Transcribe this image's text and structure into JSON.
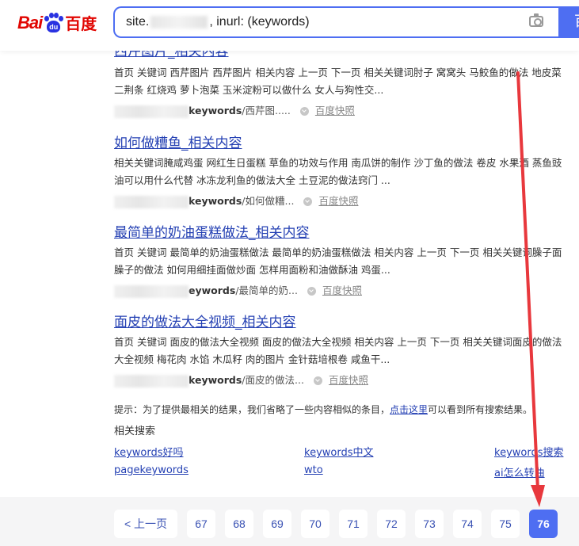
{
  "header": {
    "logo_latin": "Bai",
    "logo_paw": "du",
    "logo_cn": "百度",
    "search_prefix": "site.",
    "search_suffix": ", inurl: (keywords)",
    "search_button": "百"
  },
  "results": [
    {
      "title": "西芹图片_相关内容",
      "abstract": "首页 关键词 西芹图片 西芹图片 相关内容 上一页 下一页 相关关键词肘子 窝窝头 马鲛鱼的做法 地皮菜 二荆条 红烧鸡 萝卜泡菜 玉米淀粉可以做什么 女人与狗性交...",
      "url_bold": "keywords",
      "url_rest": "/西芹图.....",
      "snapshot": "百度快照"
    },
    {
      "title": "如何做糟鱼_相关内容",
      "abstract": "相关关键词腌咸鸡蛋 网红生日蛋糕 草鱼的功效与作用 南瓜饼的制作 沙丁鱼的做法 卷皮 水果酒 蒸鱼豉油可以用什么代替 冰冻龙利鱼的做法大全 土豆泥的做法窍门 ...",
      "url_bold": "keywords",
      "url_rest": "/如何做糟...",
      "snapshot": "百度快照"
    },
    {
      "title": "最简单的奶油蛋糕做法_相关内容",
      "abstract": "首页 关键词 最简单的奶油蛋糕做法 最简单的奶油蛋糕做法 相关内容 上一页 下一页 相关关键词臊子面臊子的做法 如何用细挂面做炒面 怎样用面粉和油做酥油 鸡蛋...",
      "url_bold": "eywords",
      "url_rest": "/最简单的奶...",
      "snapshot": "百度快照"
    },
    {
      "title": "面皮的做法大全视频_相关内容",
      "abstract": "首页 关键词 面皮的做法大全视频 面皮的做法大全视频 相关内容 上一页 下一页 相关关键词面皮的做法大全视频 梅花肉 水馅 木瓜籽 肉的图片 金针菇培根卷 咸鱼干...",
      "url_bold": "keywords",
      "url_rest": "/面皮的做法...",
      "snapshot": "百度快照"
    }
  ],
  "tip": {
    "prefix": "提示：为了提供最相关的结果，我们省略了一些内容相似的条目，",
    "link": "点击这里",
    "suffix": "可以看到所有搜索结果。"
  },
  "related": {
    "title": "相关搜索",
    "links": [
      "keywords好吗",
      "keywords中文",
      "keywords搜索",
      "pagekeywords",
      "wto",
      "ai怎么转曲"
    ]
  },
  "pagination": {
    "prev": "< 上一页",
    "pages": [
      "67",
      "68",
      "69",
      "70",
      "71",
      "72",
      "73",
      "74",
      "75",
      "76"
    ],
    "current": "76"
  },
  "colors": {
    "brand_red": "#e10602",
    "brand_blue": "#2932e1",
    "link": "#2440b3",
    "accent": "#4e6ef2",
    "annotation_arrow": "#e8383d"
  }
}
